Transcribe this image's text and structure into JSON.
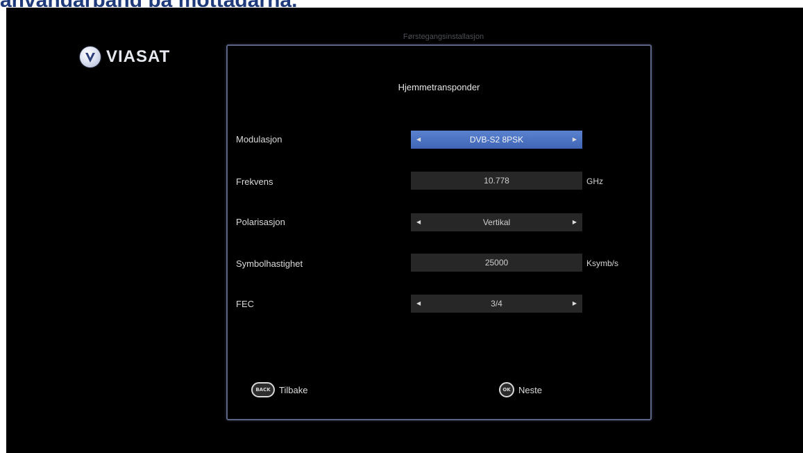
{
  "page_heading": "användarband på mottagarna.",
  "logo": {
    "brand": "VIASAT",
    "mark_icon": "viasat-v-logo-icon"
  },
  "screen_title": "Førstegangsinstallasjon",
  "dialog": {
    "title": "Hjemmetransponder",
    "rows": [
      {
        "label": "Modulasjon",
        "value": "DVB-S2 8PSK",
        "type": "selector",
        "selected": true,
        "unit": ""
      },
      {
        "label": "Frekvens",
        "value": "10.778",
        "type": "input",
        "selected": false,
        "unit": "GHz"
      },
      {
        "label": "Polarisasjon",
        "value": "Vertikal",
        "type": "selector",
        "selected": false,
        "unit": ""
      },
      {
        "label": "Symbolhastighet",
        "value": "25000",
        "type": "input",
        "selected": false,
        "unit": "Ksymb/s"
      },
      {
        "label": "FEC",
        "value": "3/4",
        "type": "selector",
        "selected": false,
        "unit": ""
      }
    ],
    "arrows": {
      "left": "◀",
      "right": "▶"
    },
    "footer": {
      "back": {
        "key": "BACK",
        "label": "Tilbake",
        "icon": "back-key-icon"
      },
      "next": {
        "key": "OK",
        "label": "Neste",
        "icon": "ok-key-icon"
      }
    }
  }
}
